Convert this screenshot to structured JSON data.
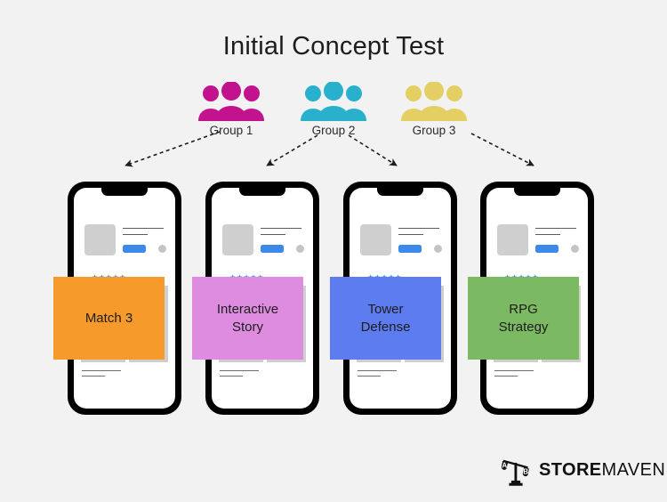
{
  "page": {
    "title": "Initial Concept Test",
    "background_color": "#f2f2f2"
  },
  "groups": [
    {
      "label": "Group 1",
      "color": "#c2128d",
      "icon": "people-group-icon"
    },
    {
      "label": "Group 2",
      "color": "#29b0cc",
      "icon": "people-group-icon"
    },
    {
      "label": "Group 3",
      "color": "#e3cf63",
      "icon": "people-group-icon"
    }
  ],
  "phones": [
    {
      "concept_label": "Match 3",
      "concept_color": "#f59a2b",
      "store_page": {
        "install_label": "",
        "rating_stars": "★★★★★",
        "star_color": "#3b8aea",
        "install_button_color": "#3b8aea"
      }
    },
    {
      "concept_label": "Interactive\nStory",
      "concept_color": "#dd8ce0",
      "store_page": {
        "install_label": "",
        "rating_stars": "★★★★★",
        "star_color": "#3b8aea",
        "install_button_color": "#3b8aea"
      }
    },
    {
      "concept_label": "Tower\nDefense",
      "concept_color": "#5c7cf0",
      "store_page": {
        "install_label": "",
        "rating_stars": "★★★★★",
        "star_color": "#3b8aea",
        "install_button_color": "#3b8aea"
      }
    },
    {
      "concept_label": "RPG\nStrategy",
      "concept_color": "#7cb963",
      "store_page": {
        "install_label": "",
        "rating_stars": "★★★★★",
        "star_color": "#3b8aea",
        "install_button_color": "#3b8aea"
      }
    }
  ],
  "logo": {
    "brand_bold": "STORE",
    "brand_light": "MAVEN",
    "scale_left_label": "A",
    "scale_right_label": "B",
    "mark": "ab-balance-scale-icon"
  }
}
